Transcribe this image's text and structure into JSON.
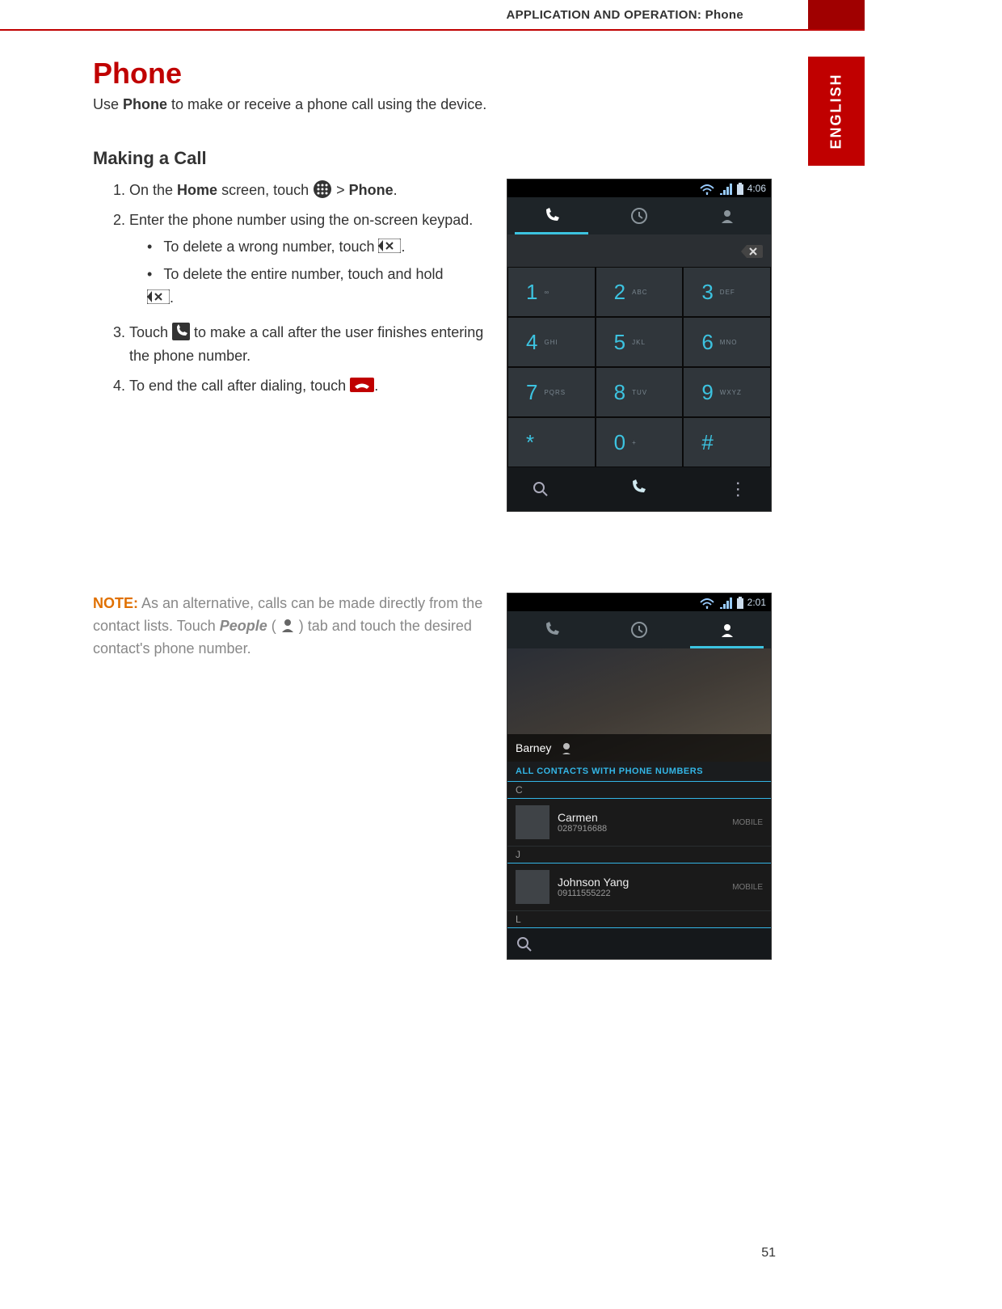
{
  "header": {
    "breadcrumb": "APPLICATION AND OPERATION: Phone",
    "language_tab": "ENGLISH"
  },
  "page": {
    "title": "Phone",
    "intro_pre": "Use ",
    "intro_bold": "Phone",
    "intro_post": " to make or receive a phone call using the device.",
    "page_number": "51"
  },
  "section": {
    "heading": "Making a Call",
    "steps": {
      "s1_a": "On the ",
      "s1_b": "Home",
      "s1_c": " screen, touch ",
      "s1_d": " > ",
      "s1_e": "Phone",
      "s1_f": ".",
      "s2": "Enter the phone number using the on-screen keypad.",
      "s2_sub1_a": "To delete a wrong number, touch ",
      "s2_sub1_b": ".",
      "s2_sub2_a": "To delete the entire number, touch and hold ",
      "s2_sub2_b": ".",
      "s3_a": "Touch ",
      "s3_b": " to make a call after the user finishes entering the phone number.",
      "s4_a": "To end the call after dialing, touch ",
      "s4_b": "."
    }
  },
  "note": {
    "label": "NOTE:",
    "text_a": " As an alternative, calls can be made directly from the contact lists. Touch ",
    "text_b_italic": "People",
    "text_c": " ( ",
    "text_d": " ) tab and touch the desired contact's phone number."
  },
  "screenshot1": {
    "status_time": "4:06",
    "keypad": [
      {
        "num": "1",
        "let": "∞"
      },
      {
        "num": "2",
        "let": "ABC"
      },
      {
        "num": "3",
        "let": "DEF"
      },
      {
        "num": "4",
        "let": "GHI"
      },
      {
        "num": "5",
        "let": "JKL"
      },
      {
        "num": "6",
        "let": "MNO"
      },
      {
        "num": "7",
        "let": "PQRS"
      },
      {
        "num": "8",
        "let": "TUV"
      },
      {
        "num": "9",
        "let": "WXYZ"
      },
      {
        "num": "*",
        "let": ""
      },
      {
        "num": "0",
        "let": "+"
      },
      {
        "num": "#",
        "let": ""
      }
    ]
  },
  "screenshot2": {
    "status_time": "2:01",
    "card_name": "Barney",
    "section_header": "ALL CONTACTS WITH PHONE NUMBERS",
    "groups": [
      {
        "letter": "C",
        "contacts": [
          {
            "name": "Carmen",
            "number": "0287916688",
            "type": "MOBILE"
          }
        ]
      },
      {
        "letter": "J",
        "contacts": [
          {
            "name": "Johnson Yang",
            "number": "09111555222",
            "type": "MOBILE"
          }
        ]
      },
      {
        "letter": "L",
        "contacts": []
      }
    ]
  }
}
